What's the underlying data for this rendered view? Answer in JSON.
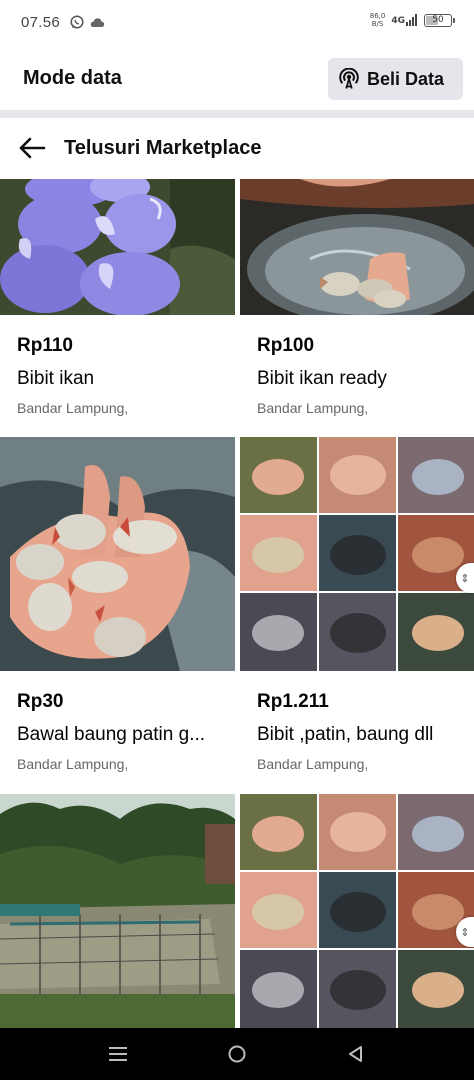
{
  "status_bar": {
    "time": "07.56",
    "net_speed_value": "86,0",
    "net_speed_unit": "B/S",
    "network": "4G",
    "battery": "50",
    "icons": [
      "whatsapp-icon",
      "cloud-icon",
      "signal-icon",
      "battery-icon"
    ]
  },
  "mode_header": {
    "title": "Mode data",
    "buy_button_label": "Beli Data",
    "buy_button_icon": "broadcast-icon"
  },
  "marketplace_header": {
    "title": "Telusuri Marketplace",
    "back_icon": "back-arrow-icon"
  },
  "listings": [
    {
      "price": "Rp110",
      "name": "Bibit ikan",
      "location": "Bandar Lampung,"
    },
    {
      "price": "Rp100",
      "name": "Bibit ikan ready",
      "location": "Bandar Lampung,"
    },
    {
      "price": "Rp30",
      "name": "Bawal baung patin g...",
      "location": "Bandar Lampung,"
    },
    {
      "price": "Rp1.211",
      "name": "Bibit ,patin, baung dll",
      "location": "Bandar Lampung,"
    }
  ],
  "nav_bar": {
    "buttons": [
      "menu-icon",
      "home-icon",
      "back-icon"
    ]
  },
  "colors": {
    "button_bg": "#e4e6eb",
    "separator": "#e6e7ea",
    "secondary_text": "#65676b",
    "nav_bg": "#000000"
  }
}
